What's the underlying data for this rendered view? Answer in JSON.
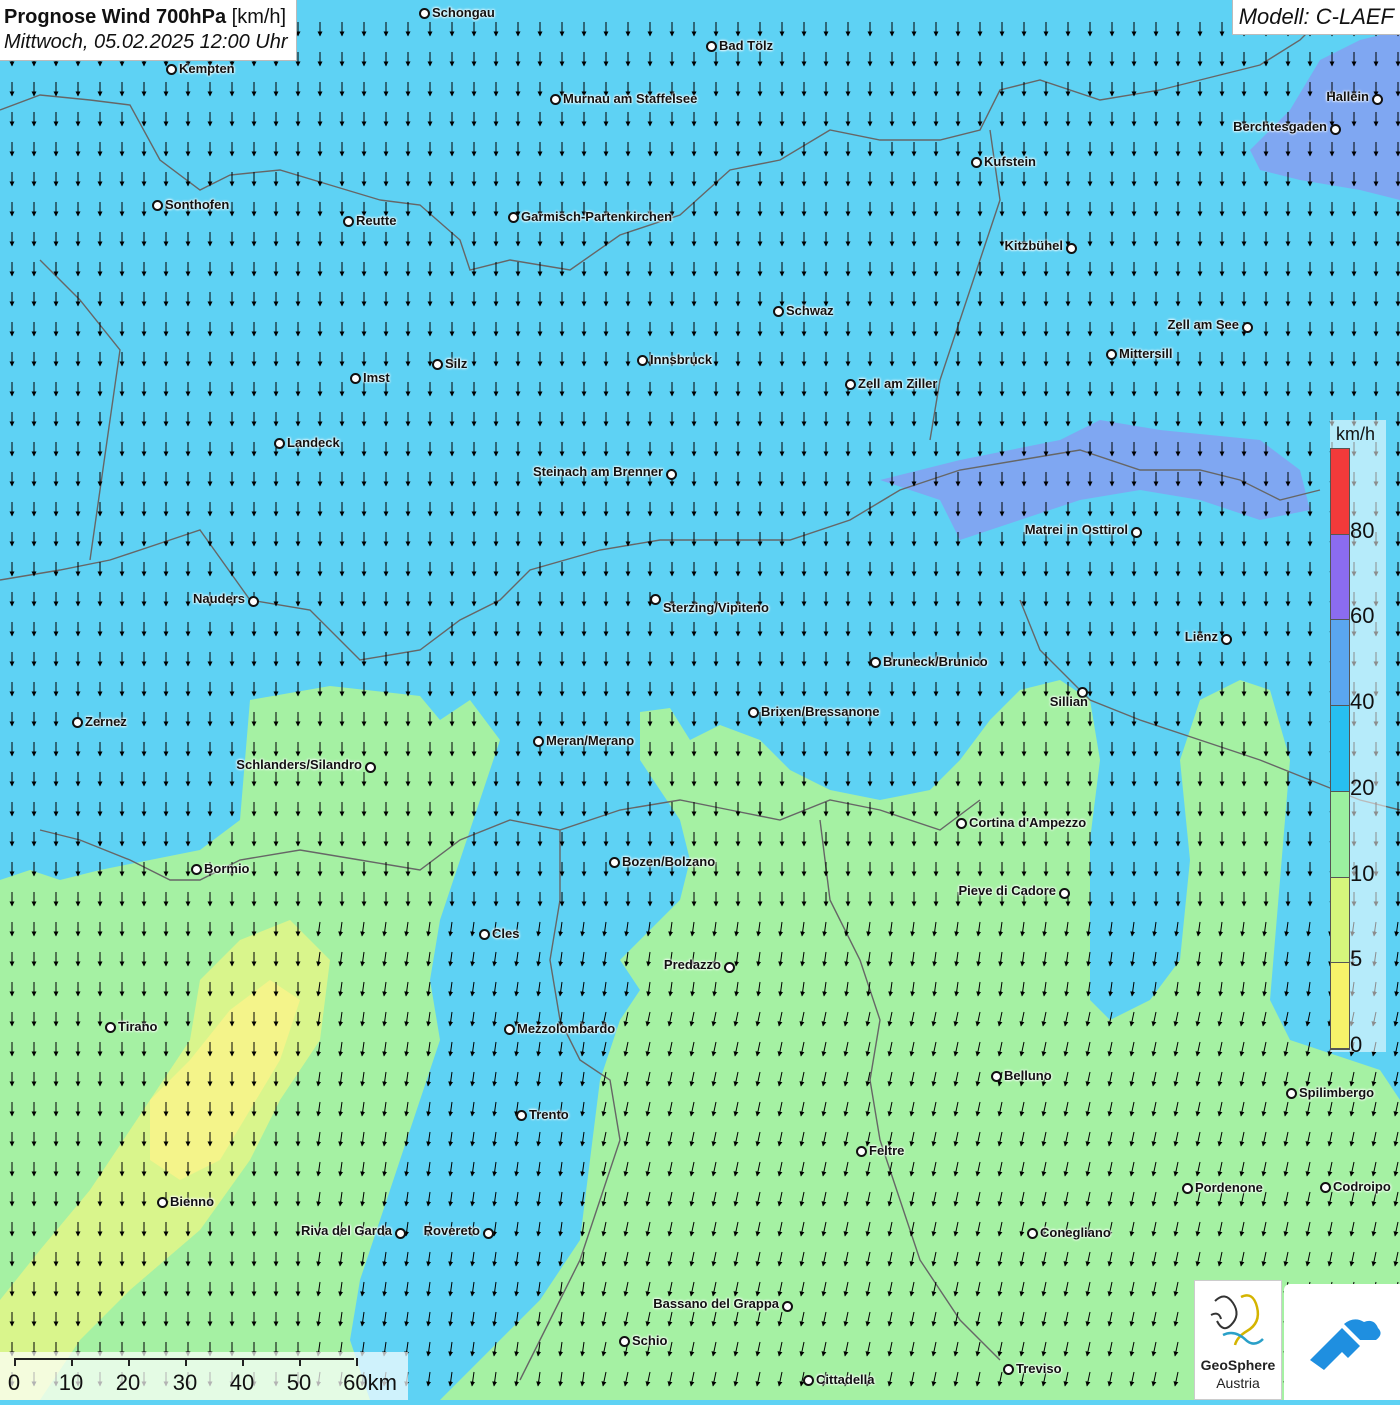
{
  "title": {
    "main": "Prognose Wind 700hPa",
    "unit": "[km/h]",
    "datetime": "Mittwoch, 05.02.2025 12:00 Uhr"
  },
  "model": "Modell: C-LAEF",
  "legend": {
    "unit": "km/h",
    "labels": [
      "0",
      "5",
      "10",
      "20",
      "40",
      "60",
      "80"
    ],
    "colors": [
      "#f7f36a",
      "#d5f57c",
      "#9bf0a0",
      "#27bff0",
      "#5aa6ef",
      "#8b6cf0",
      "#f23a3a"
    ]
  },
  "scalebar": {
    "labels": [
      "0",
      "10",
      "20",
      "30",
      "40",
      "50",
      "60km"
    ]
  },
  "logos": {
    "geosphere_line1": "GeoSphere",
    "geosphere_line2": "Austria"
  },
  "cities": [
    {
      "name": "Schongau"
    },
    {
      "name": "Kempten"
    },
    {
      "name": "Bad Tölz"
    },
    {
      "name": "Murnau am Staffelsee"
    },
    {
      "name": "Hallein"
    },
    {
      "name": "Berchtesgaden"
    },
    {
      "name": "Kufstein"
    },
    {
      "name": "Sonthofen"
    },
    {
      "name": "Reutte"
    },
    {
      "name": "Garmisch-Partenkirchen"
    },
    {
      "name": "Kitzbühel"
    },
    {
      "name": "Schwaz"
    },
    {
      "name": "Zell am See"
    },
    {
      "name": "Mittersill"
    },
    {
      "name": "Innsbruck"
    },
    {
      "name": "Silz"
    },
    {
      "name": "Imst"
    },
    {
      "name": "Zell am Ziller"
    },
    {
      "name": "Landeck"
    },
    {
      "name": "Steinach am Brenner"
    },
    {
      "name": "Matrei in Osttirol"
    },
    {
      "name": "Nauders"
    },
    {
      "name": "Sterzing/Vipiteno"
    },
    {
      "name": "Lienz"
    },
    {
      "name": "Bruneck/Brunico"
    },
    {
      "name": "Sillian"
    },
    {
      "name": "Zernez"
    },
    {
      "name": "Brixen/Bressanone"
    },
    {
      "name": "Meran/Merano"
    },
    {
      "name": "Schlanders/Silandro"
    },
    {
      "name": "Cortina d'Ampezzo"
    },
    {
      "name": "Bozen/Bolzano"
    },
    {
      "name": "Bormio"
    },
    {
      "name": "Pieve di Cadore"
    },
    {
      "name": "Cles"
    },
    {
      "name": "Predazzo"
    },
    {
      "name": "Tirano"
    },
    {
      "name": "Mezzolombardo"
    },
    {
      "name": "Belluno"
    },
    {
      "name": "Spilimbergo"
    },
    {
      "name": "Trento"
    },
    {
      "name": "Feltre"
    },
    {
      "name": "Pordenone"
    },
    {
      "name": "Codroipo"
    },
    {
      "name": "Bienno"
    },
    {
      "name": "Riva del Garda"
    },
    {
      "name": "Rovereto"
    },
    {
      "name": "Conegliano"
    },
    {
      "name": "Bassano del Grappa"
    },
    {
      "name": "Schio"
    },
    {
      "name": "Treviso"
    },
    {
      "name": "Cittadella"
    }
  ]
}
